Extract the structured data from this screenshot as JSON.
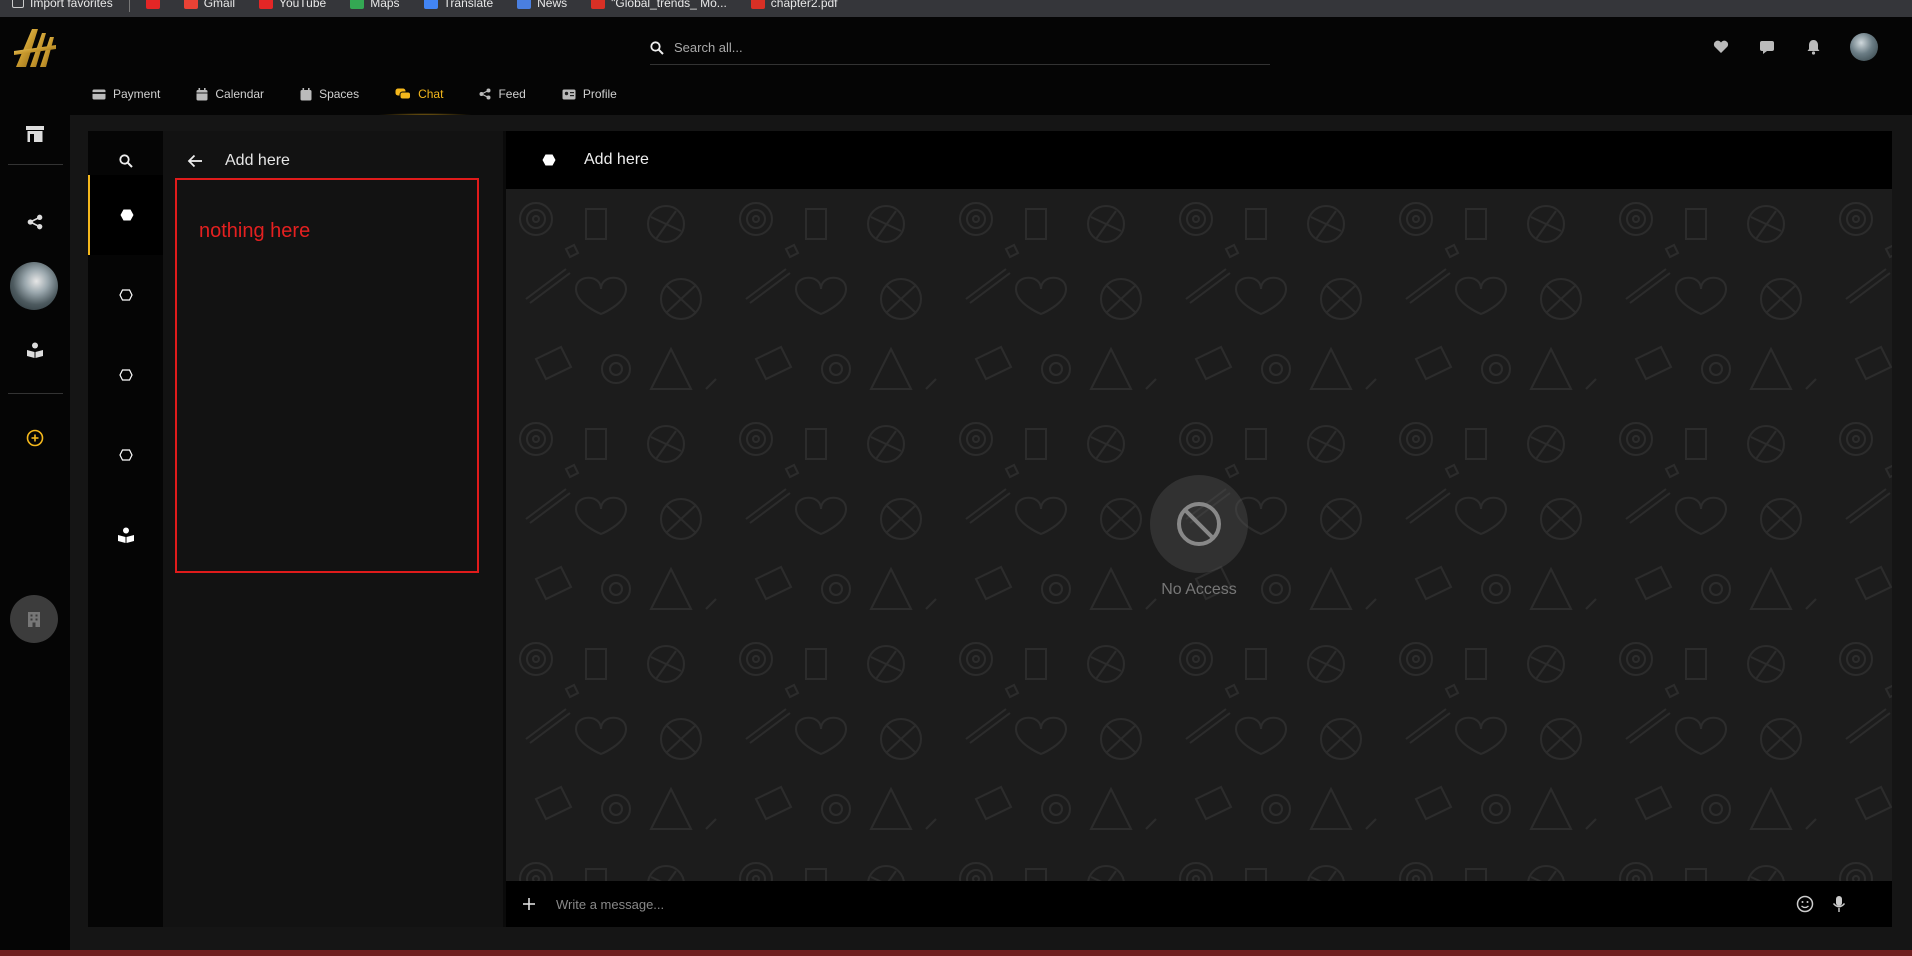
{
  "bookmarks": [
    {
      "label": "Import favorites",
      "icon": "import-icon",
      "color": "#cccccc"
    },
    {
      "label": "",
      "icon": "youtube-icon",
      "color": "#e32626"
    },
    {
      "label": "Gmail",
      "icon": "gmail-icon",
      "color": "#e94235"
    },
    {
      "label": "YouTube",
      "icon": "youtube-icon",
      "color": "#e32626"
    },
    {
      "label": "Maps",
      "icon": "maps-icon",
      "color": "#34a853"
    },
    {
      "label": "Translate",
      "icon": "translate-icon",
      "color": "#4285f4"
    },
    {
      "label": "News",
      "icon": "news-icon",
      "color": "#4a7fe0"
    },
    {
      "label": "\"Global_trends_ Mo...",
      "icon": "pdf-icon",
      "color": "#d93025"
    },
    {
      "label": "chapter2.pdf",
      "icon": "pdf-icon",
      "color": "#d93025"
    }
  ],
  "header": {
    "search_placeholder": "Search all...",
    "tabs": [
      {
        "label": "Payment",
        "icon": "card-icon"
      },
      {
        "label": "Calendar",
        "icon": "calendar-icon"
      },
      {
        "label": "Spaces",
        "icon": "spaces-icon"
      },
      {
        "label": "Chat",
        "icon": "chat-icon",
        "active": true
      },
      {
        "label": "Feed",
        "icon": "share-icon"
      },
      {
        "label": "Profile",
        "icon": "id-card-icon"
      }
    ]
  },
  "list": {
    "title": "Add here",
    "empty_note": "nothing here"
  },
  "chat": {
    "title": "Add here",
    "status_text": "No Access",
    "composer_placeholder": "Write a message..."
  },
  "colors": {
    "accent": "#f5b81c",
    "annotation_red": "#e01b1b"
  }
}
